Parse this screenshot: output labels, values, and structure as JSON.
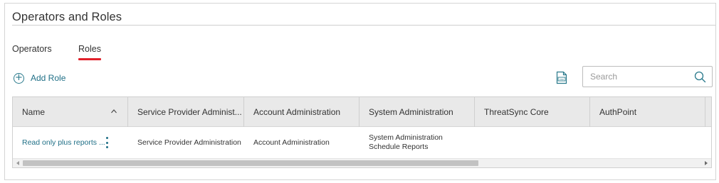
{
  "page": {
    "title": "Operators and Roles"
  },
  "tabs": [
    {
      "label": "Operators",
      "active": false
    },
    {
      "label": "Roles",
      "active": true
    }
  ],
  "toolbar": {
    "add_role_label": "Add Role",
    "add_icon": "plus-circle-icon",
    "export_icon": "csv-file-icon",
    "search_placeholder": "Search",
    "search_value": "",
    "search_icon": "magnifier-icon"
  },
  "table": {
    "columns": [
      {
        "label": "Name",
        "sort": "ascending"
      },
      {
        "label": "Service Provider Administ..."
      },
      {
        "label": "Account Administration"
      },
      {
        "label": "System Administration"
      },
      {
        "label": "ThreatSync Core"
      },
      {
        "label": "AuthPoint"
      }
    ],
    "rows": [
      {
        "name": "Read only plus reports ...",
        "service_provider_administration": "Service Provider Administration",
        "account_administration": "Account Administration",
        "system_administration": [
          "System Administration",
          "Schedule Reports"
        ],
        "threatsync_core": "",
        "authpoint": ""
      }
    ]
  },
  "colors": {
    "accent_link": "#1f6f86",
    "active_tab_underline": "#e1202a",
    "header_bg": "#e9e9e9"
  }
}
